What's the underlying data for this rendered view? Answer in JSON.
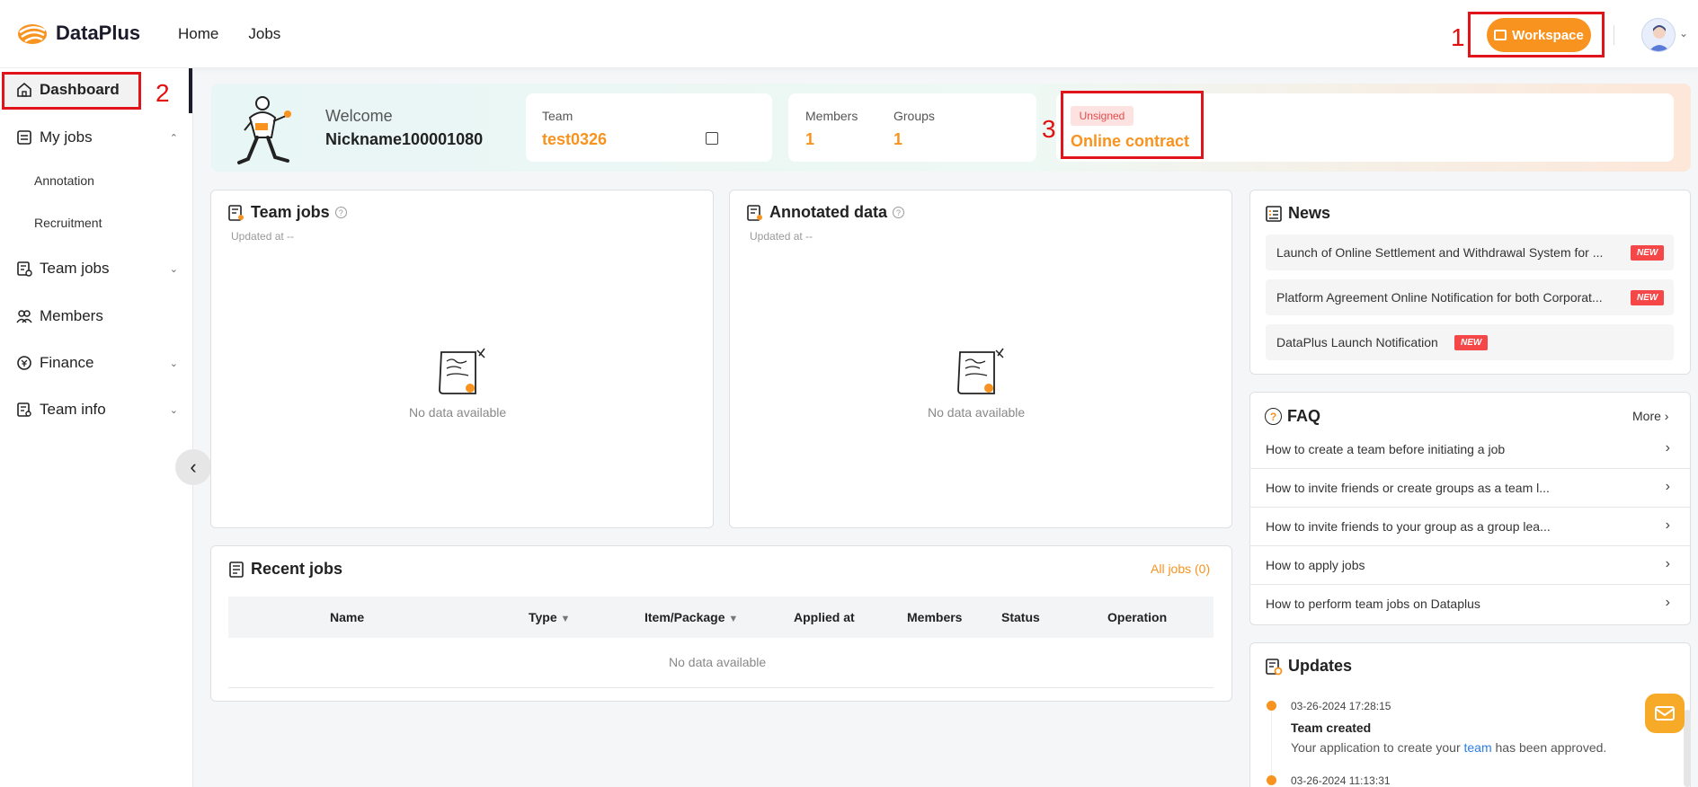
{
  "app": {
    "name": "DataPlus"
  },
  "topnav": {
    "home": "Home",
    "jobs": "Jobs"
  },
  "toolbar": {
    "workspace": "Workspace"
  },
  "annotations": {
    "one": "1",
    "two": "2",
    "three": "3"
  },
  "sidebar": {
    "dashboard": "Dashboard",
    "my_jobs": "My jobs",
    "annotation": "Annotation",
    "recruitment": "Recruitment",
    "team_jobs": "Team jobs",
    "members": "Members",
    "finance": "Finance",
    "team_info": "Team info"
  },
  "banner": {
    "welcome": "Welcome",
    "nickname": "Nickname100001080",
    "team_label": "Team",
    "team_value": "test0326",
    "members_label": "Members",
    "members_value": "1",
    "groups_label": "Groups",
    "groups_value": "1",
    "contract_badge": "Unsigned",
    "contract_link": "Online contract"
  },
  "team_jobs": {
    "title": "Team jobs",
    "updated": "Updated at --",
    "empty": "No data available"
  },
  "annotated": {
    "title": "Annotated data",
    "updated": "Updated at --",
    "empty": "No data available"
  },
  "recent": {
    "title": "Recent jobs",
    "all_jobs": "All jobs (0)",
    "columns": [
      "Name",
      "Type",
      "Item/Package",
      "Applied at",
      "Members",
      "Status",
      "Operation"
    ],
    "empty": "No data available"
  },
  "news": {
    "title": "News",
    "badge": "NEW",
    "items": [
      "Launch of Online Settlement and Withdrawal System for ...",
      "Platform Agreement Online Notification for both Corporat...",
      "DataPlus Launch Notification"
    ]
  },
  "faq": {
    "title": "FAQ",
    "more": "More",
    "items": [
      "How to create a team before initiating a job",
      "How to invite friends or create groups as a team l...",
      "How to invite friends to your group as a group lea...",
      "How to apply jobs",
      "How to perform team jobs on Dataplus"
    ]
  },
  "updates": {
    "title": "Updates",
    "items": [
      {
        "time": "03-26-2024 17:28:15",
        "title": "Team created",
        "desc_pre": "Your application to create your ",
        "desc_link": "team",
        "desc_post": " has been approved."
      },
      {
        "time": "03-26-2024 11:13:31"
      }
    ]
  },
  "colors": {
    "accent": "#f7931e",
    "annotation": "#e0141a",
    "new_badge": "#f54747"
  }
}
